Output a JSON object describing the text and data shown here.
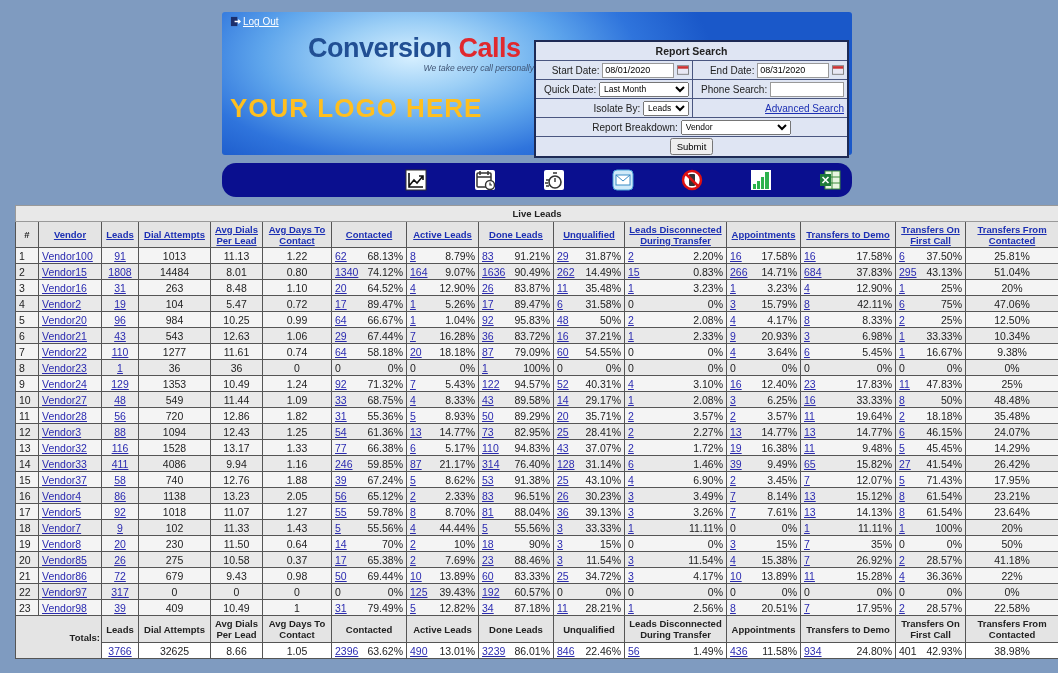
{
  "header": {
    "logout": "Log Out",
    "brand_first": "Conversion",
    "brand_second": "Calls",
    "tagline": "We take every call personally",
    "logo_placeholder": "YOUR LOGO HERE"
  },
  "search": {
    "title": "Report Search",
    "start_label": "Start Date:",
    "start_value": "08/01/2020",
    "end_label": "End Date:",
    "end_value": "08/31/2020",
    "quick_label": "Quick Date:",
    "quick_value": "Last Month",
    "phone_label": "Phone Search:",
    "isolate_label": "Isolate By:",
    "isolate_value": "Leads",
    "advanced_link": "Advanced Search",
    "breakdown_label": "Report Breakdown:",
    "breakdown_value": "Vendor",
    "submit": "Submit"
  },
  "table": {
    "title": "Live Leads",
    "columns": [
      {
        "label": "#",
        "link": false
      },
      {
        "label": "Vendor",
        "link": true
      },
      {
        "label": "Leads",
        "link": true
      },
      {
        "label": "Dial Attempts",
        "link": true
      },
      {
        "label": "Avg Dials Per Lead",
        "link": true
      },
      {
        "label": "Avg Days To Contact",
        "link": true
      },
      {
        "label": "Contacted",
        "link": true
      },
      {
        "label": "Active Leads",
        "link": true
      },
      {
        "label": "Done Leads",
        "link": true
      },
      {
        "label": "Unqualified",
        "link": true
      },
      {
        "label": "Leads Disconnected During Transfer",
        "link": true
      },
      {
        "label": "Appointments",
        "link": true
      },
      {
        "label": "Transfers to Demo",
        "link": true
      },
      {
        "label": "Transfers On First Call",
        "link": true
      },
      {
        "label": "Transfers From Contacted",
        "link": true
      }
    ],
    "rows": [
      [
        "1",
        "Vendor100",
        "91",
        "1013",
        "11.13",
        "1.22",
        [
          "62",
          "68.13%"
        ],
        [
          "8",
          "8.79%"
        ],
        [
          "83",
          "91.21%"
        ],
        [
          "29",
          "31.87%"
        ],
        [
          "2",
          "2.20%"
        ],
        [
          "16",
          "17.58%"
        ],
        [
          "16",
          "17.58%"
        ],
        [
          "6",
          "37.50%"
        ],
        "25.81%"
      ],
      [
        "2",
        "Vendor15",
        "1808",
        "14484",
        "8.01",
        "0.80",
        [
          "1340",
          "74.12%"
        ],
        [
          "164",
          "9.07%"
        ],
        [
          "1636",
          "90.49%"
        ],
        [
          "262",
          "14.49%"
        ],
        [
          "15",
          "0.83%"
        ],
        [
          "266",
          "14.71%"
        ],
        [
          "684",
          "37.83%"
        ],
        [
          "295",
          "43.13%"
        ],
        "51.04%"
      ],
      [
        "3",
        "Vendor16",
        "31",
        "263",
        "8.48",
        "1.10",
        [
          "20",
          "64.52%"
        ],
        [
          "4",
          "12.90%"
        ],
        [
          "26",
          "83.87%"
        ],
        [
          "11",
          "35.48%"
        ],
        [
          "1",
          "3.23%"
        ],
        [
          "1",
          "3.23%"
        ],
        [
          "4",
          "12.90%"
        ],
        [
          "1",
          "25%"
        ],
        "20%"
      ],
      [
        "4",
        "Vendor2",
        "19",
        "104",
        "5.47",
        "0.72",
        [
          "17",
          "89.47%"
        ],
        [
          "1",
          "5.26%"
        ],
        [
          "17",
          "89.47%"
        ],
        [
          "6",
          "31.58%"
        ],
        [
          "0",
          "0%"
        ],
        [
          "3",
          "15.79%"
        ],
        [
          "8",
          "42.11%"
        ],
        [
          "6",
          "75%"
        ],
        "47.06%"
      ],
      [
        "5",
        "Vendor20",
        "96",
        "984",
        "10.25",
        "0.99",
        [
          "64",
          "66.67%"
        ],
        [
          "1",
          "1.04%"
        ],
        [
          "92",
          "95.83%"
        ],
        [
          "48",
          "50%"
        ],
        [
          "2",
          "2.08%"
        ],
        [
          "4",
          "4.17%"
        ],
        [
          "8",
          "8.33%"
        ],
        [
          "2",
          "25%"
        ],
        "12.50%"
      ],
      [
        "6",
        "Vendor21",
        "43",
        "543",
        "12.63",
        "1.06",
        [
          "29",
          "67.44%"
        ],
        [
          "7",
          "16.28%"
        ],
        [
          "36",
          "83.72%"
        ],
        [
          "16",
          "37.21%"
        ],
        [
          "1",
          "2.33%"
        ],
        [
          "9",
          "20.93%"
        ],
        [
          "3",
          "6.98%"
        ],
        [
          "1",
          "33.33%"
        ],
        "10.34%"
      ],
      [
        "7",
        "Vendor22",
        "110",
        "1277",
        "11.61",
        "0.74",
        [
          "64",
          "58.18%"
        ],
        [
          "20",
          "18.18%"
        ],
        [
          "87",
          "79.09%"
        ],
        [
          "60",
          "54.55%"
        ],
        [
          "0",
          "0%"
        ],
        [
          "4",
          "3.64%"
        ],
        [
          "6",
          "5.45%"
        ],
        [
          "1",
          "16.67%"
        ],
        "9.38%"
      ],
      [
        "8",
        "Vendor23",
        "1",
        "36",
        "36",
        "0",
        [
          "0",
          "0%"
        ],
        [
          "0",
          "0%"
        ],
        [
          "1",
          "100%"
        ],
        [
          "0",
          "0%"
        ],
        [
          "0",
          "0%"
        ],
        [
          "0",
          "0%"
        ],
        [
          "0",
          "0%"
        ],
        [
          "0",
          "0%"
        ],
        "0%"
      ],
      [
        "9",
        "Vendor24",
        "129",
        "1353",
        "10.49",
        "1.24",
        [
          "92",
          "71.32%"
        ],
        [
          "7",
          "5.43%"
        ],
        [
          "122",
          "94.57%"
        ],
        [
          "52",
          "40.31%"
        ],
        [
          "4",
          "3.10%"
        ],
        [
          "16",
          "12.40%"
        ],
        [
          "23",
          "17.83%"
        ],
        [
          "11",
          "47.83%"
        ],
        "25%"
      ],
      [
        "10",
        "Vendor27",
        "48",
        "549",
        "11.44",
        "1.09",
        [
          "33",
          "68.75%"
        ],
        [
          "4",
          "8.33%"
        ],
        [
          "43",
          "89.58%"
        ],
        [
          "14",
          "29.17%"
        ],
        [
          "1",
          "2.08%"
        ],
        [
          "3",
          "6.25%"
        ],
        [
          "16",
          "33.33%"
        ],
        [
          "8",
          "50%"
        ],
        "48.48%"
      ],
      [
        "11",
        "Vendor28",
        "56",
        "720",
        "12.86",
        "1.82",
        [
          "31",
          "55.36%"
        ],
        [
          "5",
          "8.93%"
        ],
        [
          "50",
          "89.29%"
        ],
        [
          "20",
          "35.71%"
        ],
        [
          "2",
          "3.57%"
        ],
        [
          "2",
          "3.57%"
        ],
        [
          "11",
          "19.64%"
        ],
        [
          "2",
          "18.18%"
        ],
        "35.48%"
      ],
      [
        "12",
        "Vendor3",
        "88",
        "1094",
        "12.43",
        "1.25",
        [
          "54",
          "61.36%"
        ],
        [
          "13",
          "14.77%"
        ],
        [
          "73",
          "82.95%"
        ],
        [
          "25",
          "28.41%"
        ],
        [
          "2",
          "2.27%"
        ],
        [
          "13",
          "14.77%"
        ],
        [
          "13",
          "14.77%"
        ],
        [
          "6",
          "46.15%"
        ],
        "24.07%"
      ],
      [
        "13",
        "Vendor32",
        "116",
        "1528",
        "13.17",
        "1.33",
        [
          "77",
          "66.38%"
        ],
        [
          "6",
          "5.17%"
        ],
        [
          "110",
          "94.83%"
        ],
        [
          "43",
          "37.07%"
        ],
        [
          "2",
          "1.72%"
        ],
        [
          "19",
          "16.38%"
        ],
        [
          "11",
          "9.48%"
        ],
        [
          "5",
          "45.45%"
        ],
        "14.29%"
      ],
      [
        "14",
        "Vendor33",
        "411",
        "4086",
        "9.94",
        "1.16",
        [
          "246",
          "59.85%"
        ],
        [
          "87",
          "21.17%"
        ],
        [
          "314",
          "76.40%"
        ],
        [
          "128",
          "31.14%"
        ],
        [
          "6",
          "1.46%"
        ],
        [
          "39",
          "9.49%"
        ],
        [
          "65",
          "15.82%"
        ],
        [
          "27",
          "41.54%"
        ],
        "26.42%"
      ],
      [
        "15",
        "Vendor37",
        "58",
        "740",
        "12.76",
        "1.88",
        [
          "39",
          "67.24%"
        ],
        [
          "5",
          "8.62%"
        ],
        [
          "53",
          "91.38%"
        ],
        [
          "25",
          "43.10%"
        ],
        [
          "4",
          "6.90%"
        ],
        [
          "2",
          "3.45%"
        ],
        [
          "7",
          "12.07%"
        ],
        [
          "5",
          "71.43%"
        ],
        "17.95%"
      ],
      [
        "16",
        "Vendor4",
        "86",
        "1138",
        "13.23",
        "2.05",
        [
          "56",
          "65.12%"
        ],
        [
          "2",
          "2.33%"
        ],
        [
          "83",
          "96.51%"
        ],
        [
          "26",
          "30.23%"
        ],
        [
          "3",
          "3.49%"
        ],
        [
          "7",
          "8.14%"
        ],
        [
          "13",
          "15.12%"
        ],
        [
          "8",
          "61.54%"
        ],
        "23.21%"
      ],
      [
        "17",
        "Vendor5",
        "92",
        "1018",
        "11.07",
        "1.27",
        [
          "55",
          "59.78%"
        ],
        [
          "8",
          "8.70%"
        ],
        [
          "81",
          "88.04%"
        ],
        [
          "36",
          "39.13%"
        ],
        [
          "3",
          "3.26%"
        ],
        [
          "7",
          "7.61%"
        ],
        [
          "13",
          "14.13%"
        ],
        [
          "8",
          "61.54%"
        ],
        "23.64%"
      ],
      [
        "18",
        "Vendor7",
        "9",
        "102",
        "11.33",
        "1.43",
        [
          "5",
          "55.56%"
        ],
        [
          "4",
          "44.44%"
        ],
        [
          "5",
          "55.56%"
        ],
        [
          "3",
          "33.33%"
        ],
        [
          "1",
          "11.11%"
        ],
        [
          "0",
          "0%"
        ],
        [
          "1",
          "11.11%"
        ],
        [
          "1",
          "100%"
        ],
        "20%"
      ],
      [
        "19",
        "Vendor8",
        "20",
        "230",
        "11.50",
        "0.64",
        [
          "14",
          "70%"
        ],
        [
          "2",
          "10%"
        ],
        [
          "18",
          "90%"
        ],
        [
          "3",
          "15%"
        ],
        [
          "0",
          "0%"
        ],
        [
          "3",
          "15%"
        ],
        [
          "7",
          "35%"
        ],
        [
          "0",
          "0%"
        ],
        "50%"
      ],
      [
        "20",
        "Vendor85",
        "26",
        "275",
        "10.58",
        "0.37",
        [
          "17",
          "65.38%"
        ],
        [
          "2",
          "7.69%"
        ],
        [
          "23",
          "88.46%"
        ],
        [
          "3",
          "11.54%"
        ],
        [
          "3",
          "11.54%"
        ],
        [
          "4",
          "15.38%"
        ],
        [
          "7",
          "26.92%"
        ],
        [
          "2",
          "28.57%"
        ],
        "41.18%"
      ],
      [
        "21",
        "Vendor86",
        "72",
        "679",
        "9.43",
        "0.98",
        [
          "50",
          "69.44%"
        ],
        [
          "10",
          "13.89%"
        ],
        [
          "60",
          "83.33%"
        ],
        [
          "25",
          "34.72%"
        ],
        [
          "3",
          "4.17%"
        ],
        [
          "10",
          "13.89%"
        ],
        [
          "11",
          "15.28%"
        ],
        [
          "4",
          "36.36%"
        ],
        "22%"
      ],
      [
        "22",
        "Vendor97",
        "317",
        "0",
        "0",
        "0",
        [
          "0",
          "0%"
        ],
        [
          "125",
          "39.43%"
        ],
        [
          "192",
          "60.57%"
        ],
        [
          "0",
          "0%"
        ],
        [
          "0",
          "0%"
        ],
        [
          "0",
          "0%"
        ],
        [
          "0",
          "0%"
        ],
        [
          "0",
          "0%"
        ],
        "0%"
      ],
      [
        "23",
        "Vendor98",
        "39",
        "409",
        "10.49",
        "1",
        [
          "31",
          "79.49%"
        ],
        [
          "5",
          "12.82%"
        ],
        [
          "34",
          "87.18%"
        ],
        [
          "11",
          "28.21%"
        ],
        [
          "1",
          "2.56%"
        ],
        [
          "8",
          "20.51%"
        ],
        [
          "7",
          "17.95%"
        ],
        [
          "2",
          "28.57%"
        ],
        "22.58%"
      ]
    ],
    "totals": {
      "label": "Totals:",
      "headers": [
        "Leads",
        "Dial Attempts",
        "Avg Dials Per Lead",
        "Avg Days To Contact",
        "Contacted",
        "Active Leads",
        "Done Leads",
        "Unqualified",
        "Leads Disconnected During Transfer",
        "Appointments",
        "Transfers to Demo",
        "Transfers On First Call",
        "Transfers From Contacted"
      ],
      "cells": [
        {
          "text": "3766",
          "linked": true
        },
        {
          "text": "32625",
          "linked": false
        },
        {
          "text": "8.66",
          "linked": false
        },
        {
          "text": "1.05",
          "linked": false
        },
        {
          "count": "2396",
          "linked": true,
          "pct": "63.62%"
        },
        {
          "count": "490",
          "linked": true,
          "pct": "13.01%"
        },
        {
          "count": "3239",
          "linked": true,
          "pct": "86.01%"
        },
        {
          "count": "846",
          "linked": true,
          "pct": "22.46%"
        },
        {
          "count": "56",
          "linked": true,
          "pct": "1.49%"
        },
        {
          "count": "436",
          "linked": true,
          "pct": "11.58%"
        },
        {
          "count": "934",
          "linked": true,
          "pct": "24.80%"
        },
        {
          "count": "401",
          "linked": false,
          "pct": "42.93%"
        },
        {
          "text": "38.98%",
          "linked": false
        }
      ]
    }
  }
}
